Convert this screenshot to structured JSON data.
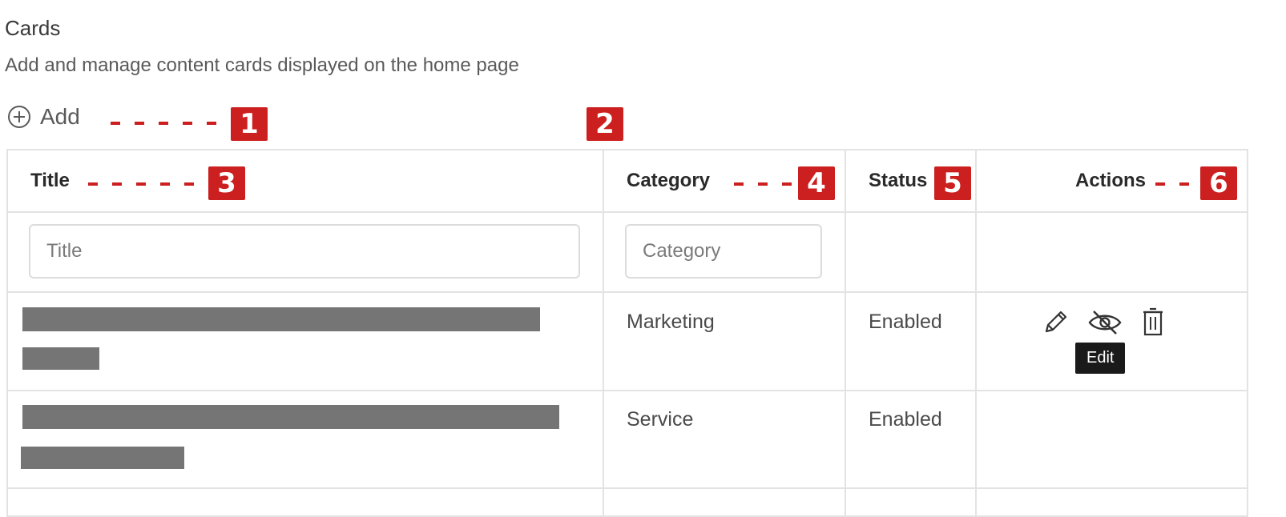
{
  "page": {
    "title": "Cards",
    "description": "Add and manage content cards displayed on the home page"
  },
  "toolbar": {
    "add_label": "Add",
    "add_icon": "plus-circle-icon"
  },
  "annotations": [
    "1",
    "2",
    "3",
    "4",
    "5",
    "6"
  ],
  "table": {
    "headers": {
      "title": "Title",
      "category": "Category",
      "status": "Status",
      "actions": "Actions"
    },
    "filters": {
      "title_placeholder": "Title",
      "category_placeholder": "Category"
    },
    "rows": [
      {
        "title": "",
        "category": "Marketing",
        "status": "Enabled",
        "actions": [
          "edit-pencil-icon",
          "eye-off-icon",
          "trash-icon"
        ]
      },
      {
        "title": "",
        "category": "Service",
        "status": "Enabled",
        "actions": []
      }
    ],
    "tooltip": "Edit"
  },
  "colors": {
    "annotation": "#cc1f1f",
    "redaction": "#757575",
    "tooltip_bg": "#1a1a1a",
    "border": "#e3e3e3"
  }
}
